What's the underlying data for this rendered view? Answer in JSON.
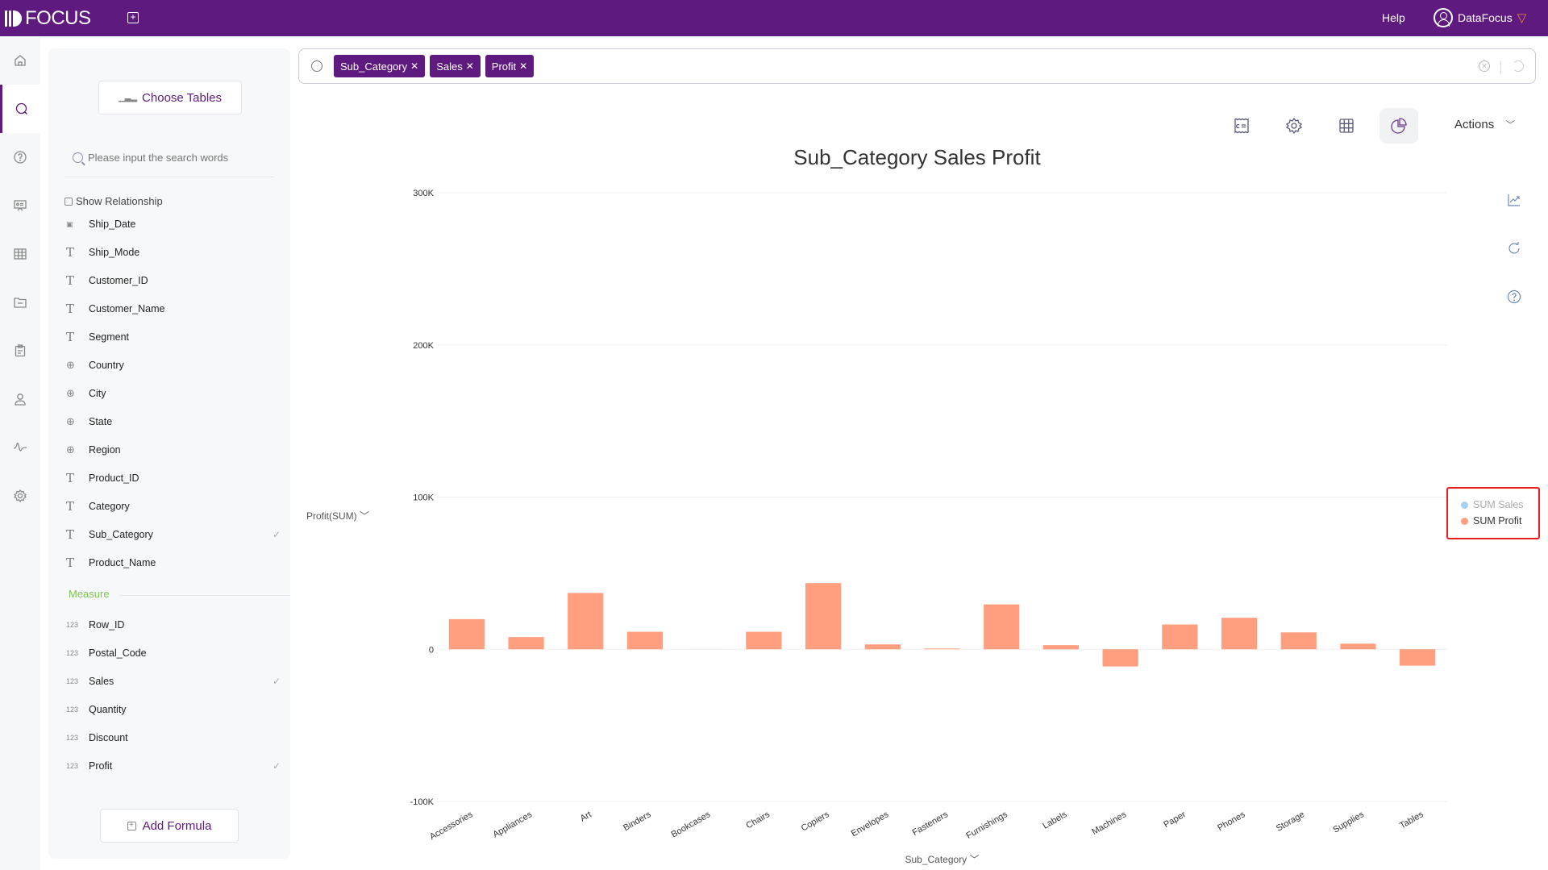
{
  "app": {
    "logo_text": "FOCUS",
    "help_label": "Help",
    "user_name": "DataFocus",
    "vip_icon": "diamond-icon"
  },
  "nav": {
    "items": [
      {
        "name": "home",
        "icon": "home-icon"
      },
      {
        "name": "search",
        "icon": "search-icon",
        "active": true
      },
      {
        "name": "help",
        "icon": "question-icon"
      },
      {
        "name": "presentation",
        "icon": "presentation-icon"
      },
      {
        "name": "table",
        "icon": "table-icon"
      },
      {
        "name": "folder",
        "icon": "folder-icon"
      },
      {
        "name": "clipboard",
        "icon": "clipboard-icon"
      },
      {
        "name": "user",
        "icon": "user-icon"
      },
      {
        "name": "pulse",
        "icon": "pulse-icon"
      },
      {
        "name": "settings",
        "icon": "gear-icon"
      }
    ]
  },
  "panel": {
    "choose_tables_label": "Choose Tables",
    "search_placeholder": "Please input the search words",
    "show_relationship_label": "Show Relationship",
    "dimension_fields": [
      {
        "label": "Ship_Date",
        "type": "date"
      },
      {
        "label": "Ship_Mode",
        "type": "text"
      },
      {
        "label": "Customer_ID",
        "type": "text"
      },
      {
        "label": "Customer_Name",
        "type": "text"
      },
      {
        "label": "Segment",
        "type": "text"
      },
      {
        "label": "Country",
        "type": "geo"
      },
      {
        "label": "City",
        "type": "geo"
      },
      {
        "label": "State",
        "type": "geo"
      },
      {
        "label": "Region",
        "type": "geo"
      },
      {
        "label": "Product_ID",
        "type": "text"
      },
      {
        "label": "Category",
        "type": "text"
      },
      {
        "label": "Sub_Category",
        "type": "text",
        "checked": true
      },
      {
        "label": "Product_Name",
        "type": "text"
      }
    ],
    "measure_label": "Measure",
    "measure_fields": [
      {
        "label": "Row_ID",
        "type": "number"
      },
      {
        "label": "Postal_Code",
        "type": "number"
      },
      {
        "label": "Sales",
        "type": "number",
        "checked": true
      },
      {
        "label": "Quantity",
        "type": "number"
      },
      {
        "label": "Discount",
        "type": "number"
      },
      {
        "label": "Profit",
        "type": "number",
        "checked": true
      }
    ],
    "type_glyphs": {
      "text": "T",
      "geo": "⊕",
      "number": "123",
      "date": "▣"
    },
    "add_formula_label": "Add Formula"
  },
  "searchbar": {
    "tokens": [
      "Sub_Category",
      "Sales",
      "Profit"
    ]
  },
  "toolbar": {
    "buttons": [
      "answer-summary-icon",
      "gear-icon",
      "table-icon",
      "chart-type-icon"
    ],
    "actions_label": "Actions"
  },
  "side_icons": [
    "trend-icon",
    "refresh-icon",
    "question-icon"
  ],
  "chart_data": {
    "type": "bar",
    "title": "Sub_Category Sales Profit",
    "xlabel": "Sub_Category",
    "ylabel": "Profit(SUM)",
    "ylim": [
      -100000,
      300000
    ],
    "yticks": [
      -100000,
      0,
      100000,
      200000,
      300000
    ],
    "ytick_labels": [
      "-100K",
      "0",
      "100K",
      "200K",
      "300K"
    ],
    "grid": true,
    "categories": [
      "Accessories",
      "Appliances",
      "Art",
      "Binders",
      "Bookcases",
      "Chairs",
      "Copiers",
      "Envelopes",
      "Fasteners",
      "Furnishings",
      "Labels",
      "Machines",
      "Paper",
      "Phones",
      "Storage",
      "Supplies",
      "Tables"
    ],
    "series": [
      {
        "name": "SUM Sales",
        "color": "#a6d1ef",
        "visible": false,
        "values": []
      },
      {
        "name": "SUM Profit",
        "color": "#ff9f7f",
        "visible": true,
        "values": [
          19800,
          8000,
          37000,
          11500,
          0,
          11500,
          43500,
          3200,
          500,
          29500,
          2700,
          -11300,
          16300,
          20700,
          11100,
          3700,
          -10800
        ]
      }
    ],
    "legend": {
      "position": "right",
      "entries": [
        "SUM Sales",
        "SUM Profit"
      ],
      "highlighted": true
    }
  }
}
